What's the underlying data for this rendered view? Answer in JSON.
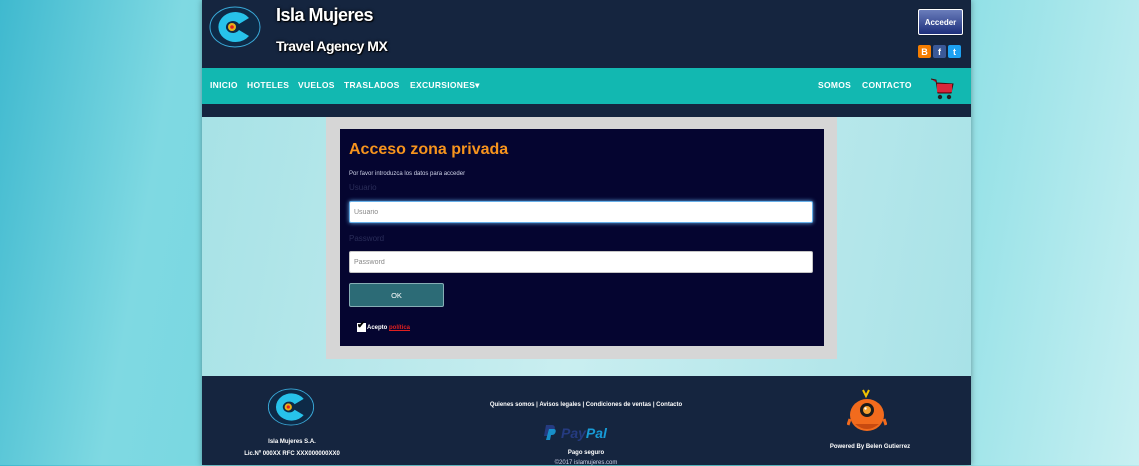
{
  "header": {
    "site_title": "Isla Mujeres",
    "site_subtitle": "Travel Agency MX",
    "login_button": "Acceder",
    "social": {
      "blogger": "B",
      "facebook": "f",
      "twitter": "t"
    }
  },
  "nav": {
    "items": [
      "INICIO",
      "HOTELES",
      "VUELOS",
      "TRASLADOS",
      "EXCURSIONES▾"
    ],
    "right_items": [
      "SOMOS",
      "CONTACTO"
    ]
  },
  "login": {
    "title": "Acceso zona privada",
    "instructions": "Por favor introduzca los datos para acceder",
    "user_label": "Usuario",
    "user_placeholder": "Usuario",
    "password_label": "Password",
    "password_placeholder": "Password",
    "ok_button": "OK",
    "accept_text": "Acepto",
    "policy_link": "política",
    "accept_checked": true
  },
  "footer": {
    "company_name": "Isla Mujeres S.A.",
    "license": "Lic.Nº 000XX RFC XXX000000XX0",
    "links": [
      "Quienes somos",
      "Avisos legales",
      "Condiciones de ventas",
      "Contacto"
    ],
    "paypal_text": "PayPal",
    "payment_note": "Pago seguro",
    "copyright": "©2017 islamujeres.com",
    "powered_by": "Powered By Belen Gutierrez"
  },
  "colors": {
    "header_bg": "#15253f",
    "nav_bg": "#12b8b1",
    "panel_bg": "#050530",
    "accent_orange": "#f7941d",
    "button_bg": "#2c6b76"
  }
}
